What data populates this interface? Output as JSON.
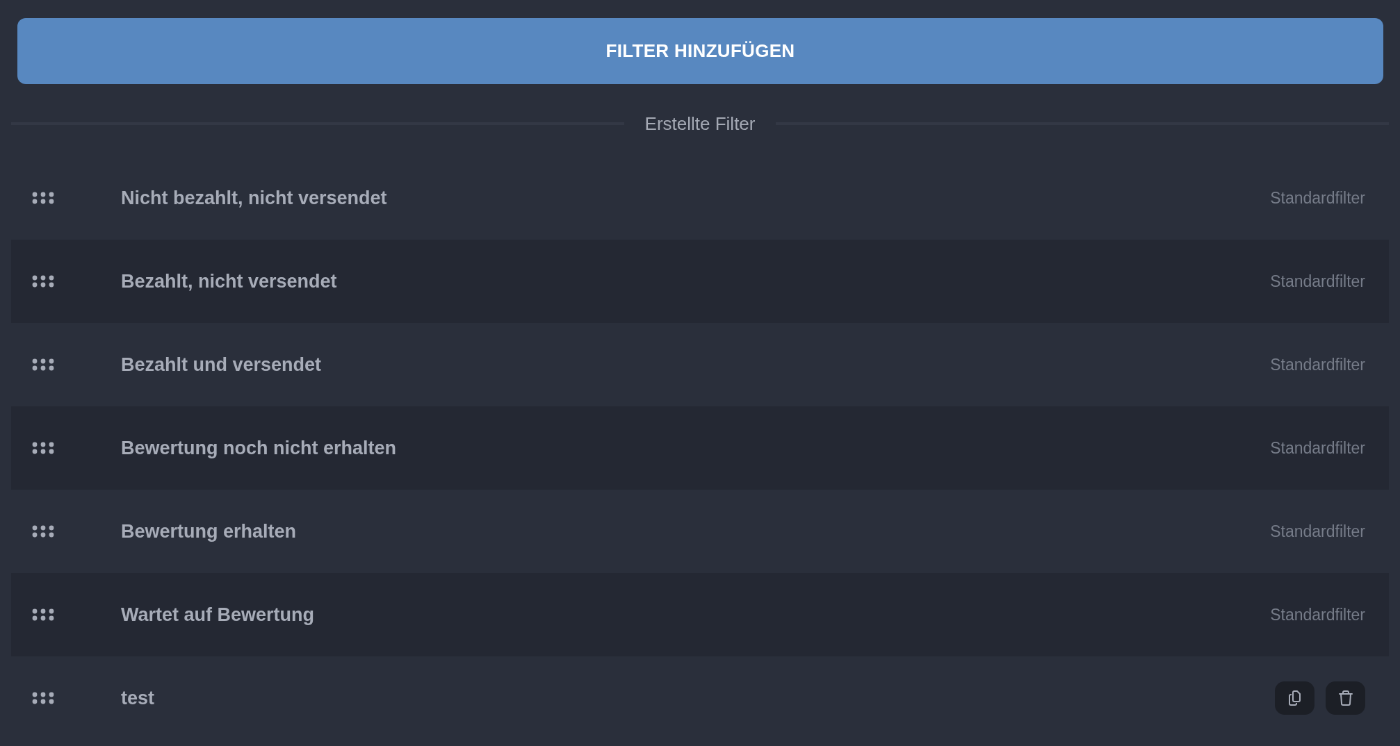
{
  "add_button": {
    "label": "FILTER HINZUFÜGEN"
  },
  "section": {
    "title": "Erstellte Filter"
  },
  "filters": [
    {
      "name": "Nicht bezahlt, nicht versendet",
      "kind": "standard",
      "tag": "Standardfilter"
    },
    {
      "name": "Bezahlt, nicht versendet",
      "kind": "standard",
      "tag": "Standardfilter"
    },
    {
      "name": "Bezahlt und versendet",
      "kind": "standard",
      "tag": "Standardfilter"
    },
    {
      "name": "Bewertung noch nicht erhalten",
      "kind": "standard",
      "tag": "Standardfilter"
    },
    {
      "name": "Bewertung erhalten",
      "kind": "standard",
      "tag": "Standardfilter"
    },
    {
      "name": "Wartet auf Bewertung",
      "kind": "standard",
      "tag": "Standardfilter"
    },
    {
      "name": "test",
      "kind": "custom"
    }
  ]
}
